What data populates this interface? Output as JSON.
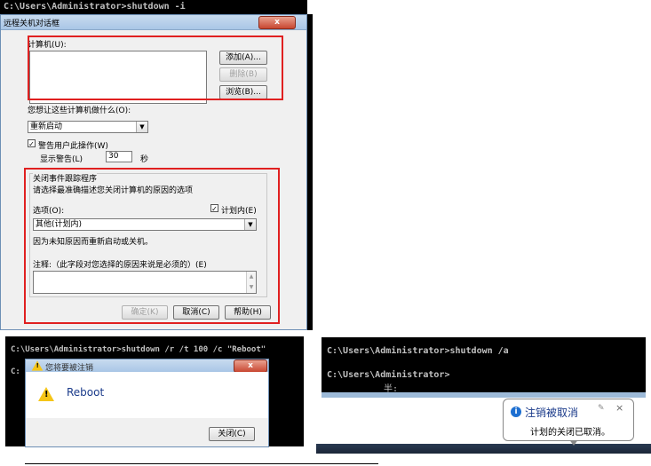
{
  "top_cmd": {
    "line": "C:\\Users\\Administrator>shutdown -i"
  },
  "remote_dialog": {
    "title": "远程关机对话框",
    "close_symbol": "x",
    "computers_label": "计算机(U):",
    "add_button": "添加(A)...",
    "remove_button": "删除(B)",
    "browse_button": "浏览(B)...",
    "action_question": "您想让这些计算机做什么(O):",
    "action_value": "重新启动",
    "warn_checkbox_label": "警告用户此操作(W)",
    "warn_checked": "✓",
    "display_warning_label": "显示警告(L)",
    "display_warning_value": "30",
    "seconds_label": "秒",
    "tracker_title": "关闭事件跟踪程序",
    "tracker_desc": "请选择最准确描述您关闭计算机的原因的选项",
    "option_label": "选项(O):",
    "planned_label": "计划内(E)",
    "planned_checked": "✓",
    "option_value": "其他(计划内)",
    "option_desc": "因为未知原因而重新启动或关机。",
    "comment_label": "注释:（此字段对您选择的原因来说是必须的）(E)",
    "ok_button": "确定(K)",
    "cancel_button": "取消(C)",
    "help_button": "帮助(H)"
  },
  "bottom_left_cmd": {
    "line1": "C:\\Users\\Administrator>shutdown /r /t 100 /c \"Reboot\"",
    "line2": "C:"
  },
  "logoff_dialog": {
    "title": "您将要被注销",
    "message": "Reboot",
    "close_button": "关闭(C)",
    "close_symbol": "x"
  },
  "bottom_right_cmd": {
    "line1": "C:\\Users\\Administrator>shutdown /a",
    "line2": "C:\\Users\\Administrator>",
    "ime": "半:"
  },
  "balloon": {
    "title": "注销被取消",
    "message": "计划的关闭已取消。",
    "info_symbol": "i",
    "close_symbol": "×"
  },
  "colors": {
    "red_highlight": "#e02020",
    "terminal_bg": "#000000",
    "titlebar": "#a9c6e6"
  }
}
